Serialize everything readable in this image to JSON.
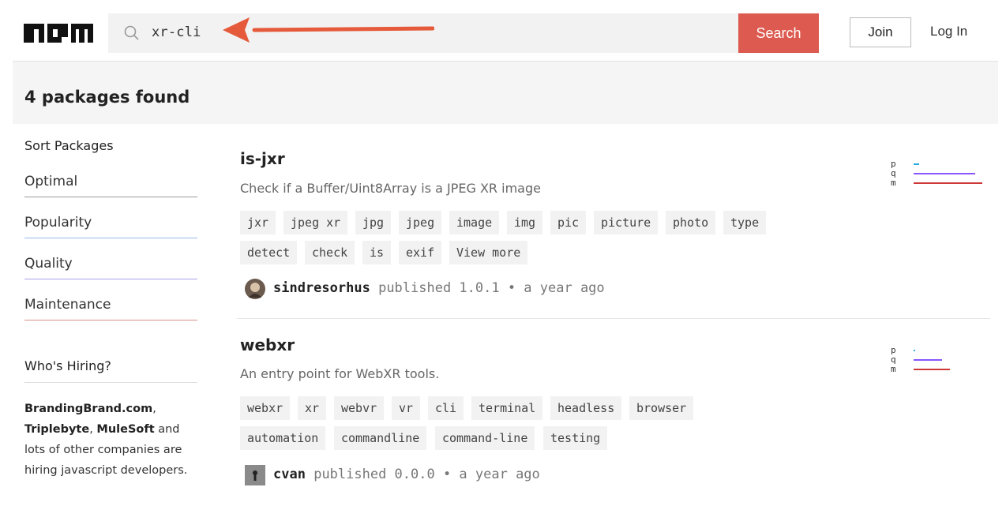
{
  "header": {
    "search_value": "xr-cli",
    "search_button": "Search",
    "join_label": "Join",
    "login_label": "Log In"
  },
  "results": {
    "count_text": "4 packages found"
  },
  "sidebar": {
    "sort_title": "Sort Packages",
    "sort_options": [
      {
        "label": "Optimal",
        "color": "#999999"
      },
      {
        "label": "Popularity",
        "color": "#9ab7e8"
      },
      {
        "label": "Quality",
        "color": "#a7a3e8"
      },
      {
        "label": "Maintenance",
        "color": "#d9908b"
      }
    ],
    "hiring_title": "Who's Hiring?",
    "hiring_companies": [
      "BrandingBrand.com",
      "Triplebyte",
      "MuleSoft"
    ],
    "hiring_rest": "and lots of other companies are hiring javascript developers."
  },
  "packages": [
    {
      "name": "is-jxr",
      "description": "Check if a Buffer/Uint8Array is a JPEG XR image",
      "tags_row1": [
        "jxr",
        "jpeg xr",
        "jpg",
        "jpeg",
        "image",
        "img",
        "pic",
        "picture",
        "photo",
        "type"
      ],
      "tags_row2": [
        "detect",
        "check",
        "is",
        "exif",
        "View more"
      ],
      "publisher": "sindresorhus",
      "published_text": "published 1.0.1 • a year ago",
      "scores": {
        "p": 0.08,
        "q": 0.85,
        "m": 0.95
      }
    },
    {
      "name": "webxr",
      "description": "An entry point for WebXR tools.",
      "tags_row1": [
        "webxr",
        "xr",
        "webvr",
        "vr",
        "cli",
        "terminal",
        "headless",
        "browser"
      ],
      "tags_row2": [
        "automation",
        "commandline",
        "command-line",
        "testing"
      ],
      "publisher": "cvan",
      "published_text": "published 0.0.0 • a year ago",
      "scores": {
        "p": 0.01,
        "q": 0.39,
        "m": 0.5
      }
    }
  ],
  "score_labels": [
    "p",
    "q",
    "m"
  ],
  "colors": {
    "brand": "#dc5a4f",
    "arrow": "#e55a3a",
    "popularity": "#29abe2",
    "quality": "#8956ff",
    "maintenance": "#cb3837"
  }
}
